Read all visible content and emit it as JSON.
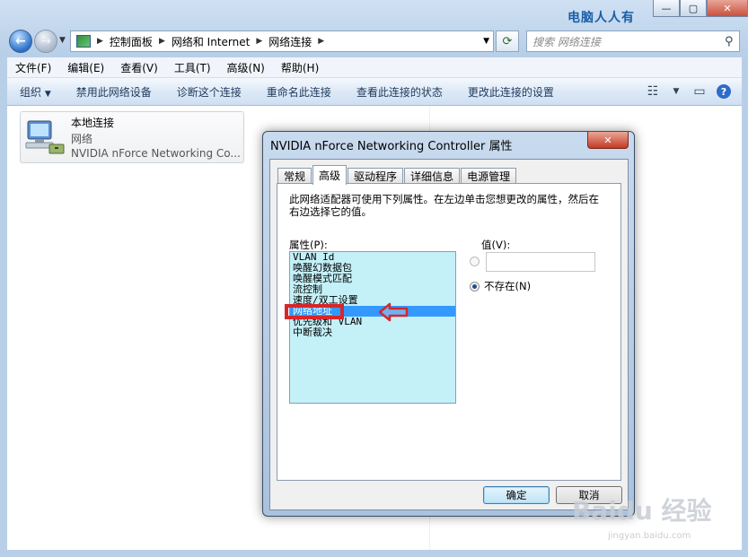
{
  "watermark_top": "电脑人人有",
  "address_bar": {
    "crumbs": [
      "控制面板",
      "网络和 Internet",
      "网络连接"
    ]
  },
  "search": {
    "placeholder": "搜索 网络连接"
  },
  "menu": [
    "文件(F)",
    "编辑(E)",
    "查看(V)",
    "工具(T)",
    "高级(N)",
    "帮助(H)"
  ],
  "toolbar": {
    "organize": "组织",
    "items": [
      "禁用此网络设备",
      "诊断这个连接",
      "重命名此连接",
      "查看此连接的状态",
      "更改此连接的设置"
    ],
    "help": "?"
  },
  "connection": {
    "name": "本地连接",
    "type": "网络",
    "adapter": "NVIDIA nForce Networking Co..."
  },
  "dialog": {
    "title": "NVIDIA nForce Networking Controller 属性",
    "tabs": [
      "常规",
      "高级",
      "驱动程序",
      "详细信息",
      "电源管理"
    ],
    "active_tab": "高级",
    "description": "此网络适配器可使用下列属性。在左边单击您想更改的属性，然后在右边选择它的值。",
    "property_label": "属性(P):",
    "properties": [
      "VLAN Id",
      "唤醒幻数据包",
      "唤醒模式匹配",
      "流控制",
      "速度/双工设置",
      "网络地址",
      "优先级和 VLAN",
      "中断裁决"
    ],
    "selected_property": "网络地址",
    "value_label": "值(V):",
    "value_text": "",
    "not_present_label": "不存在(N)",
    "ok_label": "确定",
    "cancel_label": "取消"
  },
  "watermark_bottom": "Baidu 经验",
  "watermark_bottom_url": "jingyan.baidu.com"
}
